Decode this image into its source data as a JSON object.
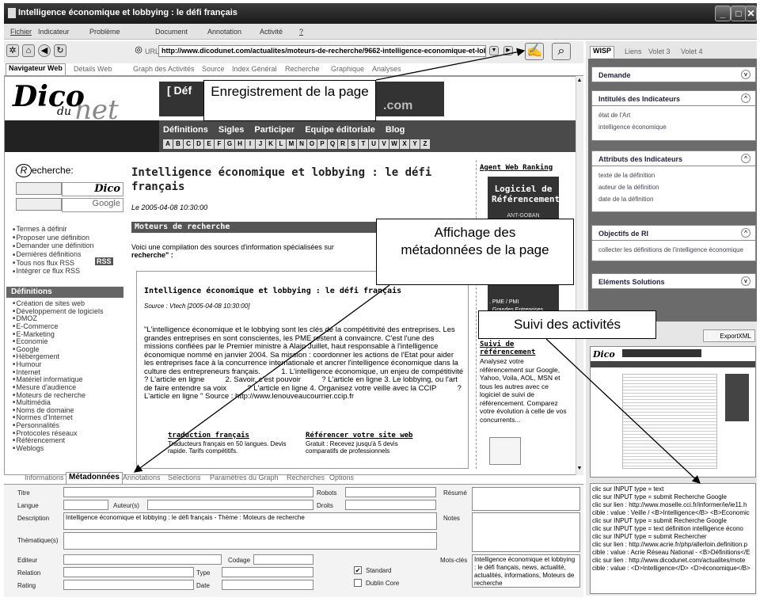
{
  "window": {
    "title": "Intelligence économique et lobbying : le défi français"
  },
  "menu": [
    "Fichier",
    "Indicateur",
    "Problème",
    "Document",
    "Annotation",
    "Activité",
    "?"
  ],
  "toolbar": {
    "url_label": "URL",
    "url": "http://www.dicodunet.com/actualites/moteurs-de-recherche/9662-intelligence-economique-et-lob"
  },
  "browser_tabs": [
    "Navigateur Web",
    "Détails Web",
    "Graph des Activités",
    "Source",
    "Index Général",
    "Recherche",
    "Graphique",
    "Analyses"
  ],
  "site": {
    "logo_main": "Dico",
    "logo_sub": "du",
    "logo_net": "net",
    "banner": "[ Déf                        ble! ]",
    "banner_com": ".com",
    "nav": [
      "Définitions",
      "Sigles",
      "Participer",
      "Equipe éditoriale",
      "Blog"
    ],
    "alphabet": [
      "A",
      "B",
      "C",
      "D",
      "E",
      "F",
      "G",
      "H",
      "I",
      "J",
      "K",
      "L",
      "M",
      "N",
      "O",
      "P",
      "Q",
      "R",
      "S",
      "T",
      "U",
      "V",
      "W",
      "X",
      "Y",
      "Z"
    ],
    "search_label": "echerche:",
    "search_r": "R",
    "search_btn1": "Dico",
    "search_btn2": "Google",
    "links1": [
      "Termes à définir",
      "Proposer une définition",
      "Demander une définition",
      "Dernières définitions",
      "Tous nos flux RSS",
      "Intégrer ce flux RSS"
    ],
    "rss": "RSS",
    "defs_title": "Définitions",
    "links2": [
      "Création de sites web",
      "Développement de logiciels",
      "DMOZ",
      "E-Commerce",
      "E-Marketing",
      "Economie",
      "Google",
      "Hébergement",
      "Humour",
      "Internet",
      "Matériel informatique",
      "Mesure d'audience",
      "Moteurs de recherche",
      "Multimédia",
      "Noms de domaine",
      "Normes d'Internet",
      "Personnalités",
      "Protocoles réseaux",
      "Référencement",
      "Weblogs"
    ],
    "article_title": "Intelligence économique et lobbying : le défi français",
    "article_date": "Le 2005-04-08 10:30:00",
    "section": "Moteurs de recherche",
    "intro": "Voici une compilation des sources d'information spécialisées sur",
    "intro2": "recherche\" :",
    "box_title": "Intelligence économique et lobbying : le défi français",
    "box_source": "Source : Vtech [2005-04-08 10:30:00]",
    "box_text": "\"L'intelligence économique et le lobbying sont les clés de la compétitivité des entreprises. Les grandes entreprises en sont conscientes, les PME restent à convaincre. C'est l'une des missions confiées par le Premier ministre à Alain Juillet, haut responsable à l'intelligence économique nommé en janvier 2004. Sa mission : coordonner les actions de l'Etat pour aider les entreprises face à la concurrence internationale et ancrer l'intelligence économique dans la culture des entrepreneurs français.          1. L'intelligence économique, un enjeu de compétitivité          ? L'article en ligne          2. Savoir, c'est pouvoir          ? L'article en ligne 3. Le lobbying, ou l'art de faire entendre sa voix          ? L'article en ligne 4. Organisez votre veille avec la CCIP          ? L'article en ligne \" Source : http://www.lenouveaucourrier.ccip.fr",
    "ad1_title": "traduction français",
    "ad1_text": "Traducteurs français en 50 langues. Devis rapide. Tarifs compétitifs.",
    "ad2_title": "Référencer votre site web",
    "ad2_text": "Gratuit : Recevez jusqu'à 5 devis comparatifs de professionnels",
    "right_title": "Agent Web Ranking",
    "right_ad1": "Logiciel de Référencement",
    "right_ad2": "ANT-GOBAN",
    "right_pme": ". PME / PMI\n. Grandes Entreprises",
    "suivi_title": "Suivi de référencement",
    "suivi_text": "Analysez votre référencement sur Google, Yahoo, Voila, AOL, MSN et tous les autres avec ce logiciel de suivi de référencement. Comparez votre évolution à celle de vos concurrents..."
  },
  "callouts": {
    "c1": "Enregistrement de la page",
    "c2": "Affichage des métadonnées de la page",
    "c3": "Suivi des activités"
  },
  "wisp": {
    "tabs": [
      "WISP",
      "Liens",
      "Volet 3",
      "Volet 4"
    ],
    "demande": "Demande",
    "sections": [
      {
        "title": "Intitulés des Indicateurs",
        "items": [
          "état de l'Art",
          "intelligence économique"
        ]
      },
      {
        "title": "Attributs des Indicateurs",
        "items": [
          "texte de la définition",
          "auteur de la définition",
          "date de la définition"
        ]
      },
      {
        "title": "Objectifs de RI",
        "items": [
          "collecter les définitions de l'intelligence économique"
        ]
      },
      {
        "title": "Eléments Solutions",
        "items": []
      }
    ],
    "export": "ExportXML"
  },
  "bottom_tabs": [
    "Informations",
    "Métadonnées",
    "Annotations",
    "Sélections",
    "Paramètres du Graph",
    "Recherches",
    "Options"
  ],
  "meta": {
    "titre": "Titre",
    "robots": "Robots",
    "resume": "Résumé",
    "langue": "Langue",
    "auteurs": "Auteur(s)",
    "droits": "Droits",
    "description": "Description",
    "description_val": "Intelligence économique et lobbying : le défi français - Thème : Moteurs de recherche",
    "notes": "Notes",
    "thematique": "Thématique(s)",
    "editeur": "Editeur",
    "codage": "Codage",
    "motscles": "Mots-clés",
    "motscles_val": "Intelligence économique et lobbying : le défi français, news, actualité, actualités, informations, Moteurs de recherche",
    "relation": "Relation",
    "type": "Type",
    "standard": "Standard",
    "rating": "Rating",
    "date": "Date",
    "dublin": "Dublin Core"
  },
  "log": [
    "clic sur INPUT type = text",
    "clic sur INPUT type = submit    Recherche Google",
    "clic sur lien : http://www.moselle.cci.fr/informer/ie/ie11.h",
    "cible :  value : Veille / <B>Intelligence</B> <B>Economic",
    "clic sur INPUT type = submit    Recherche Google",
    "clic sur INPUT type = text    définition intelligence écono",
    "clic sur INPUT type = submit    Rechercher",
    "clic sur lien : http://www.acrie.fr/php/allerloin.definition.p",
    "cible :  value : Acrie Réseau National - <B>Définitions</E",
    "clic sur lien : http://www.dicodunet.com/actualites/mote",
    "cible :  value : <D>Intelligence</D> <D>économique</B>"
  ]
}
